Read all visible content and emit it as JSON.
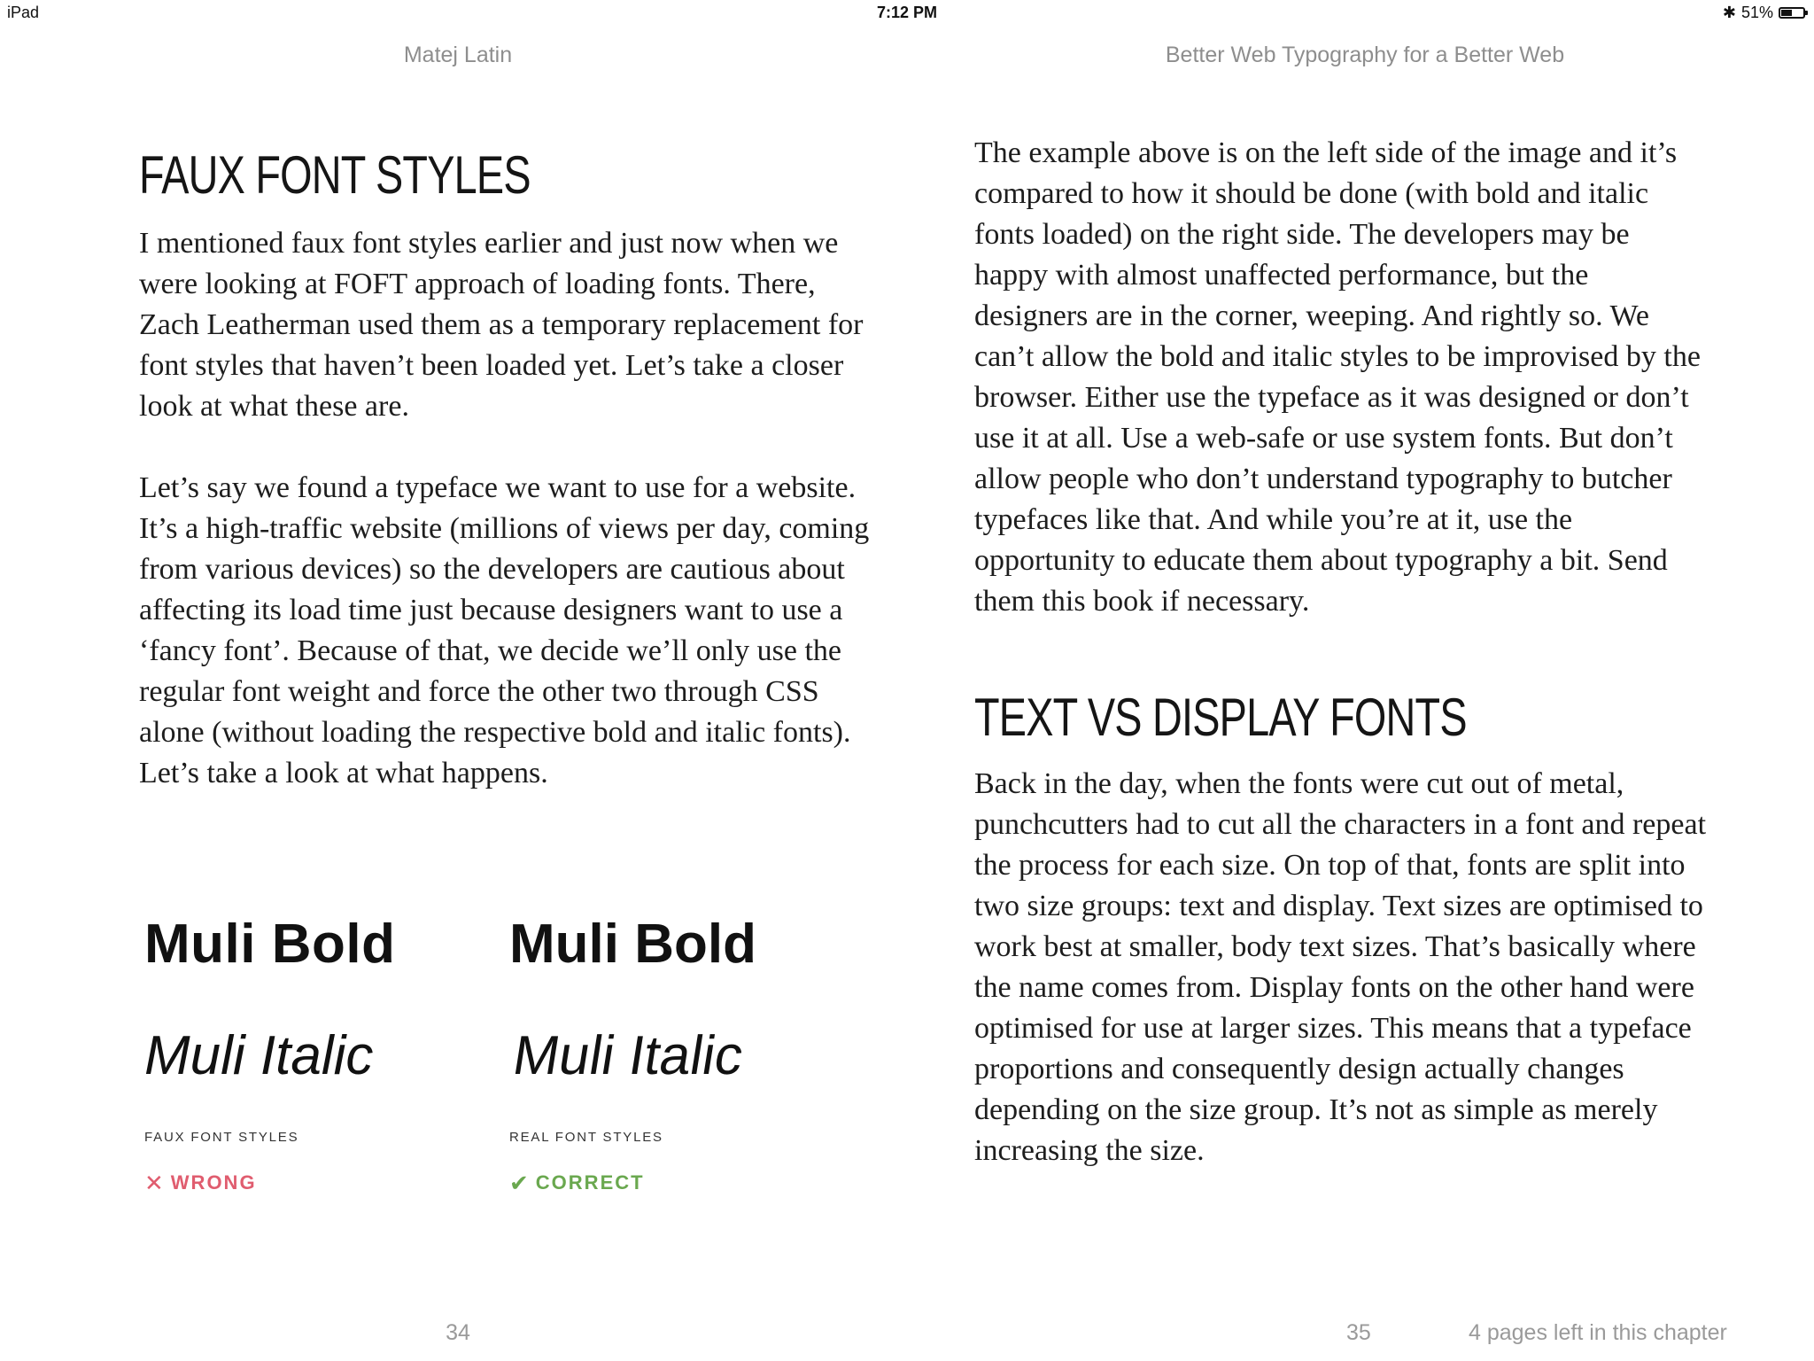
{
  "status_bar": {
    "device": "iPad",
    "time": "7:12 PM",
    "battery_percent": "51%",
    "battery_level": 0.51,
    "bluetooth_icon": "bluetooth-icon",
    "battery_icon": "battery-icon"
  },
  "book": {
    "author": "Matej Latin",
    "title": "Better Web Typography for a Better Web"
  },
  "left_page": {
    "heading": "FAUX FONT STYLES",
    "paragraphs": [
      "I mentioned faux font styles earlier and just now when we were looking at FOFT approach of loading fonts. There, Zach Leatherman used them as a temporary replacement for font styles that haven’t been loaded yet. Let’s take a closer look at what these are.",
      "Let’s say we found a typeface we want to use for a website. It’s a high-traffic website (millions of views per day, coming from various devices) so the developers are cautious about affecting its load time just because designers want to use a ‘fancy font’. Because of that, we decide we’ll only use the regular font weight and force the other two through CSS alone (without loading the respective bold and italic fonts). Let’s take a look at what happens."
    ],
    "figure": {
      "faux": {
        "bold_sample": "Muli Bold",
        "italic_sample": "Muli Italic",
        "caption": "FAUX FONT STYLES",
        "verdict": "WRONG",
        "verdict_icon": "cross-icon",
        "verdict_color": "#e05d6f"
      },
      "real": {
        "bold_sample": "Muli Bold",
        "italic_sample": "Muli Italic",
        "caption": "REAL FONT STYLES",
        "verdict": "CORRECT",
        "verdict_icon": "checkmark-icon",
        "verdict_color": "#6aa84f"
      }
    },
    "page_number": "34"
  },
  "right_page": {
    "paragraphs_top": [
      "The example above is on the left side of the image and it’s compared to how it should be done (with bold and italic fonts loaded) on the right side. The developers may be happy with almost unaffected performance, but the designers are in the corner, weeping. And rightly so. We can’t allow the bold and italic styles to be improvised by the browser. Either use the typeface as it was designed or don’t use it at all. Use a web-safe or use system fonts. But don’t allow people who don’t understand typography to butcher typefaces like that. And while you’re at it, use the opportunity to educate them about typography a bit. Send them this book if necessary."
    ],
    "heading": "TEXT VS DISPLAY FONTS",
    "paragraphs_bottom": [
      "Back in the day, when the fonts were cut out of metal, punchcutters had to cut all the characters in a font and repeat the process for each size. On top of that, fonts are split into two size groups: text and display. Text sizes are optimised to work best at smaller, body text sizes. That’s basically where the name comes from. Display fonts on the other hand were optimised for use at larger sizes. This means that a typeface proportions and consequently design actually changes depending on the size group. It’s not as simple as merely increasing the size."
    ],
    "page_number": "35",
    "pages_left": "4 pages left in this chapter"
  }
}
